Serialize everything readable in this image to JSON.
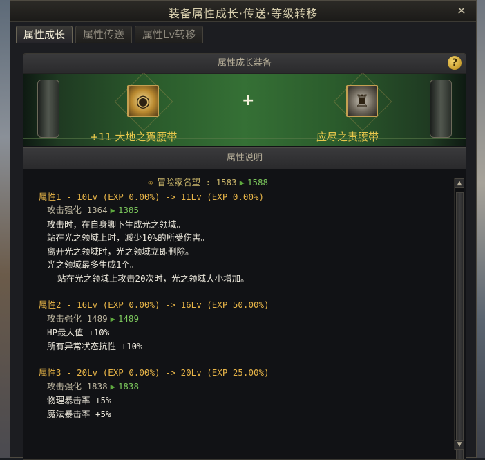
{
  "window": {
    "title": "装备属性成长·传送·等级转移",
    "close": "✕"
  },
  "tabs": [
    "属性成长",
    "属性传送",
    "属性Lv转移"
  ],
  "panel": {
    "header": "属性成长装备",
    "help": "?",
    "slot1": {
      "name": "+11 大地之翼腰带"
    },
    "slot2": {
      "name": "应尽之责腰带"
    },
    "plus": "+",
    "desc_header": "属性说明"
  },
  "renown": {
    "label": "冒险家名望 : 1583",
    "to": "1588"
  },
  "attrs": [
    {
      "title": "属性1 - 10Lv (EXP 0.00%) -> 11Lv (EXP 0.00%)",
      "power_from": "攻击强化 1364",
      "power_to": "1385",
      "lines": [
        "攻击时，在自身脚下生成光之领域。",
        "站在光之领域上时，减少10%的所受伤害。",
        "离开光之领域时，光之领域立即删除。",
        "光之领域最多生成1个。",
        "- 站在光之领域上攻击20次时，光之领域大小增加。"
      ]
    },
    {
      "title": "属性2 - 16Lv (EXP 0.00%) -> 16Lv (EXP 50.00%)",
      "power_from": "攻击强化 1489",
      "power_to": "1489",
      "lines": [
        "HP最大值 +10%",
        "所有异常状态抗性 +10%"
      ]
    },
    {
      "title": "属性3 - 20Lv (EXP 0.00%) -> 20Lv (EXP 25.00%)",
      "power_from": "攻击强化 1838",
      "power_to": "1838",
      "lines": [
        "物理暴击率 +5%",
        "魔法暴击率 +5%"
      ]
    }
  ]
}
